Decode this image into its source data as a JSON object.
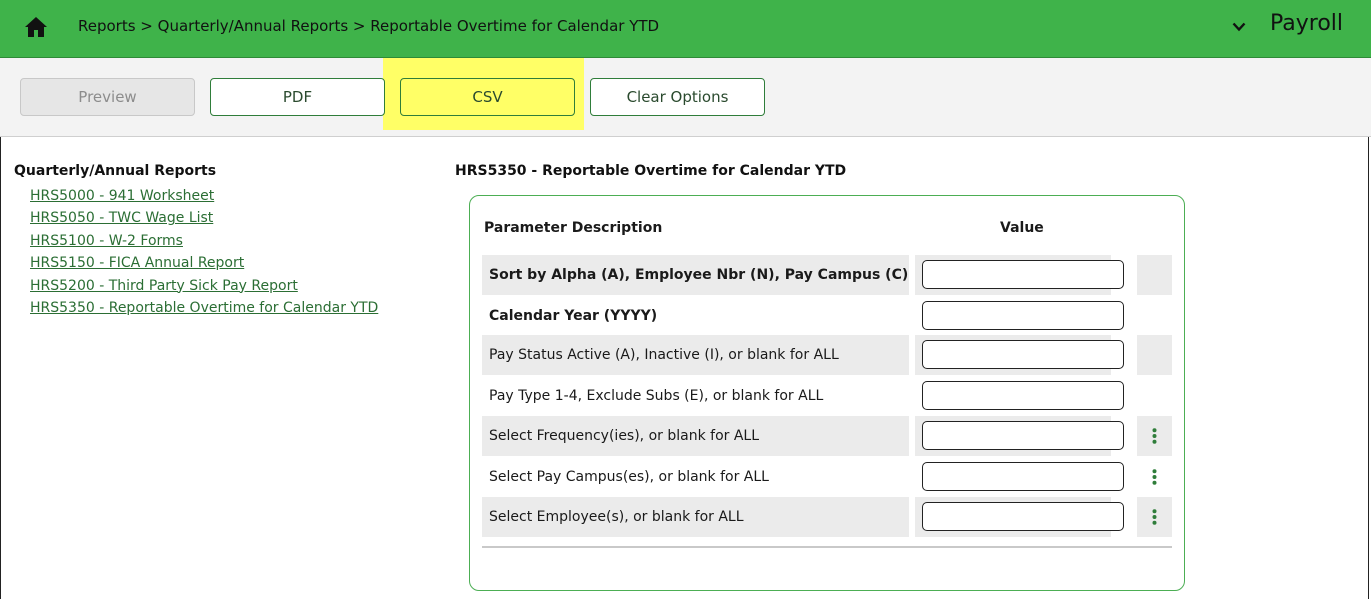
{
  "header": {
    "breadcrumb": "Reports > Quarterly/Annual Reports > Reportable Overtime for Calendar YTD",
    "app_name": "Payroll",
    "bg_color": "#3fb34a"
  },
  "toolbar": {
    "preview_label": "Preview",
    "pdf_label": "PDF",
    "csv_label": "CSV",
    "clear_label": "Clear Options",
    "highlight_color": "#ffff66"
  },
  "sidebar": {
    "title": "Quarterly/Annual Reports",
    "links": [
      "HRS5000 - 941 Worksheet",
      "HRS5050 - TWC Wage List",
      "HRS5100 - W-2 Forms",
      "HRS5150 - FICA Annual Report",
      "HRS5200 - Third Party Sick Pay Report",
      "HRS5350 - Reportable Overtime for Calendar YTD"
    ]
  },
  "report": {
    "title": "HRS5350 - Reportable Overtime for Calendar YTD",
    "col_description": "Parameter Description",
    "col_value": "Value",
    "params": [
      {
        "label": "Sort by Alpha (A), Employee Nbr (N), Pay Campus (C)",
        "value": ""
      },
      {
        "label": "Calendar Year (YYYY)",
        "value": ""
      },
      {
        "label": "Pay Status Active (A), Inactive (I), or blank for ALL",
        "value": ""
      },
      {
        "label": "Pay Type 1-4, Exclude Subs (E), or blank for ALL",
        "value": ""
      },
      {
        "label": "Select Frequency(ies), or blank for ALL",
        "value": ""
      },
      {
        "label": "Select Pay Campus(es), or blank for ALL",
        "value": ""
      },
      {
        "label": "Select Employee(s), or blank for ALL",
        "value": ""
      }
    ]
  }
}
